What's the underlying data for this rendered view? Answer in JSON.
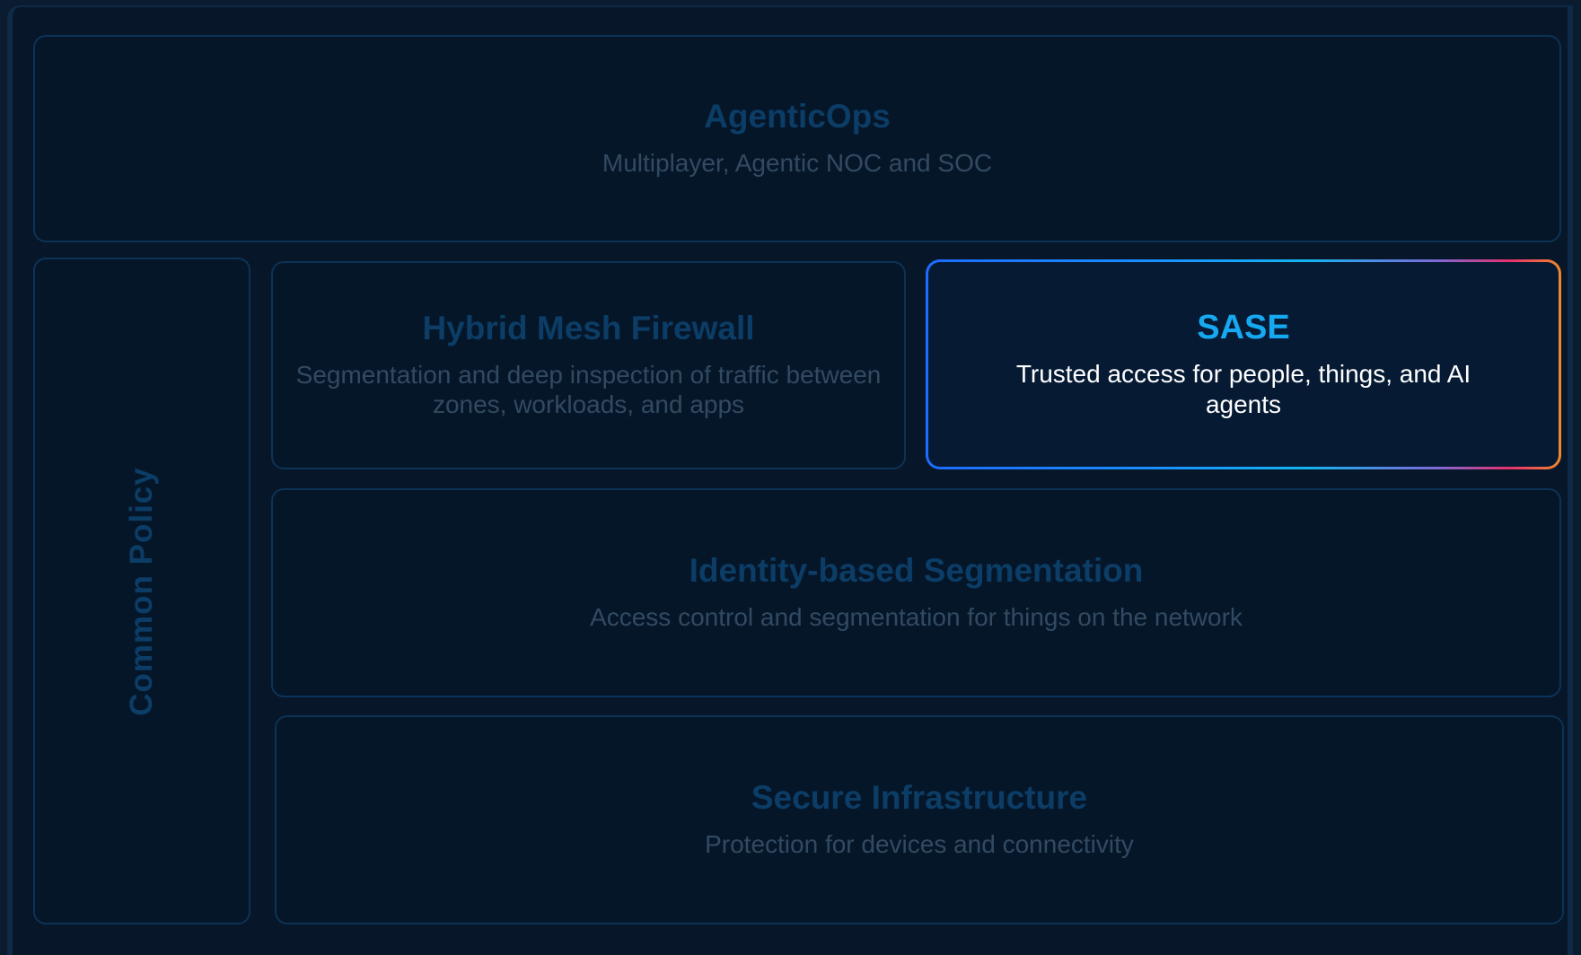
{
  "agenticops": {
    "title": "AgenticOps",
    "description": "Multiplayer, Agentic NOC and SOC"
  },
  "policy": {
    "label": "Common Policy"
  },
  "hybrid_mesh_firewall": {
    "title": "Hybrid Mesh Firewall",
    "description": "Segmentation and deep inspection of traffic between zones, workloads, and apps"
  },
  "sase": {
    "title": "SASE",
    "description": "Trusted access for people, things, and AI agents"
  },
  "identity_segmentation": {
    "title": "Identity-based Segmentation",
    "description": "Access control and segmentation for things on the network"
  },
  "secure_infrastructure": {
    "title": "Secure Infrastructure",
    "description": "Protection for devices and connectivity"
  },
  "colors": {
    "background": "#071628",
    "card_border": "#0c3357",
    "muted_title": "#0b3d66",
    "muted_text": "#324a61",
    "highlight_title": "#16a8f0",
    "highlight_text": "#ffffff"
  }
}
